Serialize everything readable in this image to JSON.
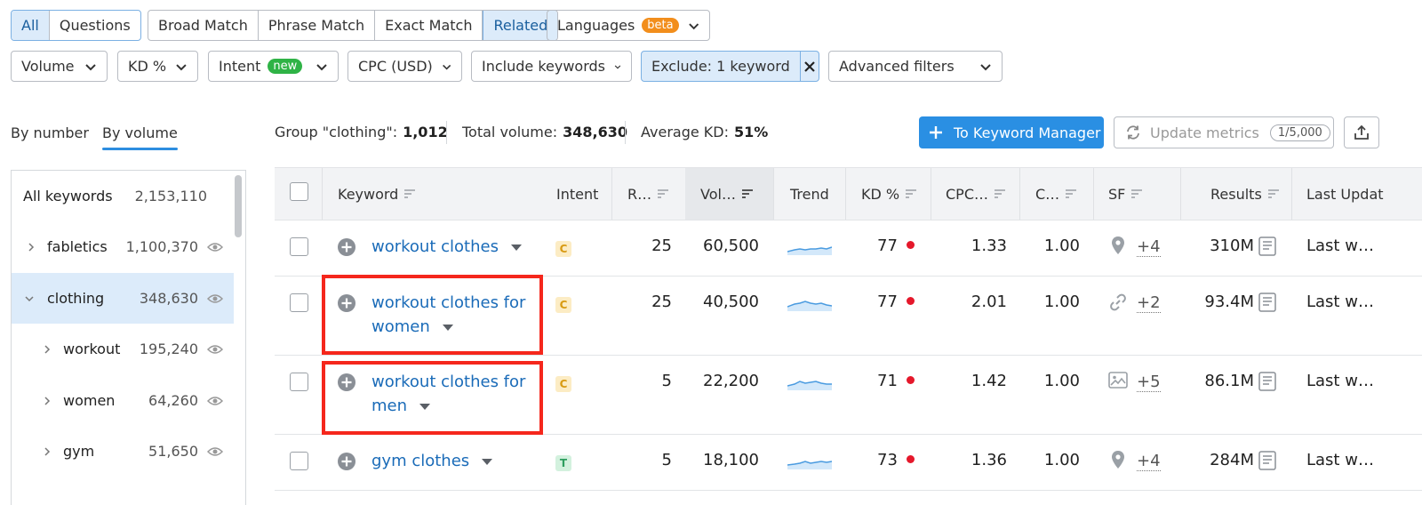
{
  "filters": {
    "match_tabs": [
      "All",
      "Questions"
    ],
    "match_types": [
      "Broad Match",
      "Phrase Match",
      "Exact Match",
      "Related"
    ],
    "languages": {
      "label": "Languages",
      "badge": "beta"
    },
    "volume": "Volume",
    "kd": "KD %",
    "intent": {
      "label": "Intent",
      "badge": "new"
    },
    "cpc": "CPC (USD)",
    "include": "Include keywords",
    "exclude": "Exclude: 1 keyword",
    "advanced": "Advanced filters"
  },
  "view_tabs": {
    "by_number": "By number",
    "by_volume": "By volume"
  },
  "stats": {
    "group_label": "Group \"clothing\":",
    "group_value": "1,012",
    "total_label": "Total volume:",
    "total_value": "348,630",
    "avg_kd_label": "Average KD:",
    "avg_kd_value": "51%"
  },
  "actions": {
    "keyword_manager": "To Keyword Manager",
    "update_metrics": "Update metrics",
    "update_quota": "1/5,000"
  },
  "sidebar": {
    "all": {
      "name": "All keywords",
      "count": "2,153,110"
    },
    "groups": [
      {
        "name": "fabletics",
        "count": "1,100,370"
      },
      {
        "name": "clothing",
        "count": "348,630"
      },
      {
        "name": "workout",
        "count": "195,240"
      },
      {
        "name": "women",
        "count": "64,260"
      },
      {
        "name": "gym",
        "count": "51,650"
      }
    ]
  },
  "table": {
    "headers": {
      "keyword": "Keyword",
      "intent": "Intent",
      "results_r": "R…",
      "volume": "Vol…",
      "trend": "Trend",
      "kd": "KD %",
      "cpc": "CPC…",
      "com": "C…",
      "sf": "SF",
      "results": "Results",
      "last_update": "Last Updat"
    },
    "rows": [
      {
        "kw1": "workout clothes",
        "kw2": "",
        "intent": "C",
        "r": "25",
        "volume": "60,500",
        "kd": "77",
        "cpc": "1.33",
        "com": "1.00",
        "sf_icon": "location-pin-icon",
        "sf_more": "+4",
        "results": "310M",
        "updated": "Last w…"
      },
      {
        "kw1": "workout clothes for",
        "kw2": "women",
        "intent": "C",
        "r": "25",
        "volume": "40,500",
        "kd": "77",
        "cpc": "2.01",
        "com": "1.00",
        "sf_icon": "link-icon",
        "sf_more": "+2",
        "results": "93.4M",
        "updated": "Last w…"
      },
      {
        "kw1": "workout clothes for",
        "kw2": "men",
        "intent": "C",
        "r": "5",
        "volume": "22,200",
        "kd": "71",
        "cpc": "1.42",
        "com": "1.00",
        "sf_icon": "image-icon",
        "sf_more": "+5",
        "results": "86.1M",
        "updated": "Last w…"
      },
      {
        "kw1": "gym clothes",
        "kw2": "",
        "intent": "T",
        "r": "5",
        "volume": "18,100",
        "kd": "73",
        "cpc": "1.36",
        "com": "1.00",
        "sf_icon": "location-pin-icon",
        "sf_more": "+4",
        "results": "284M",
        "updated": "Last w…"
      }
    ]
  },
  "colors": {
    "accent": "#2a8fe3",
    "link": "#1a6bb8",
    "highlight": "#f5271c",
    "kd_hard": "#e5182b",
    "badge_beta": "#f28e1c",
    "badge_new": "#2fb346",
    "intent_commercial_bg": "#fcecc4",
    "intent_commercial_fg": "#d89a12",
    "intent_transactional_bg": "#d3f1de",
    "intent_transactional_fg": "#2e9e5f"
  }
}
